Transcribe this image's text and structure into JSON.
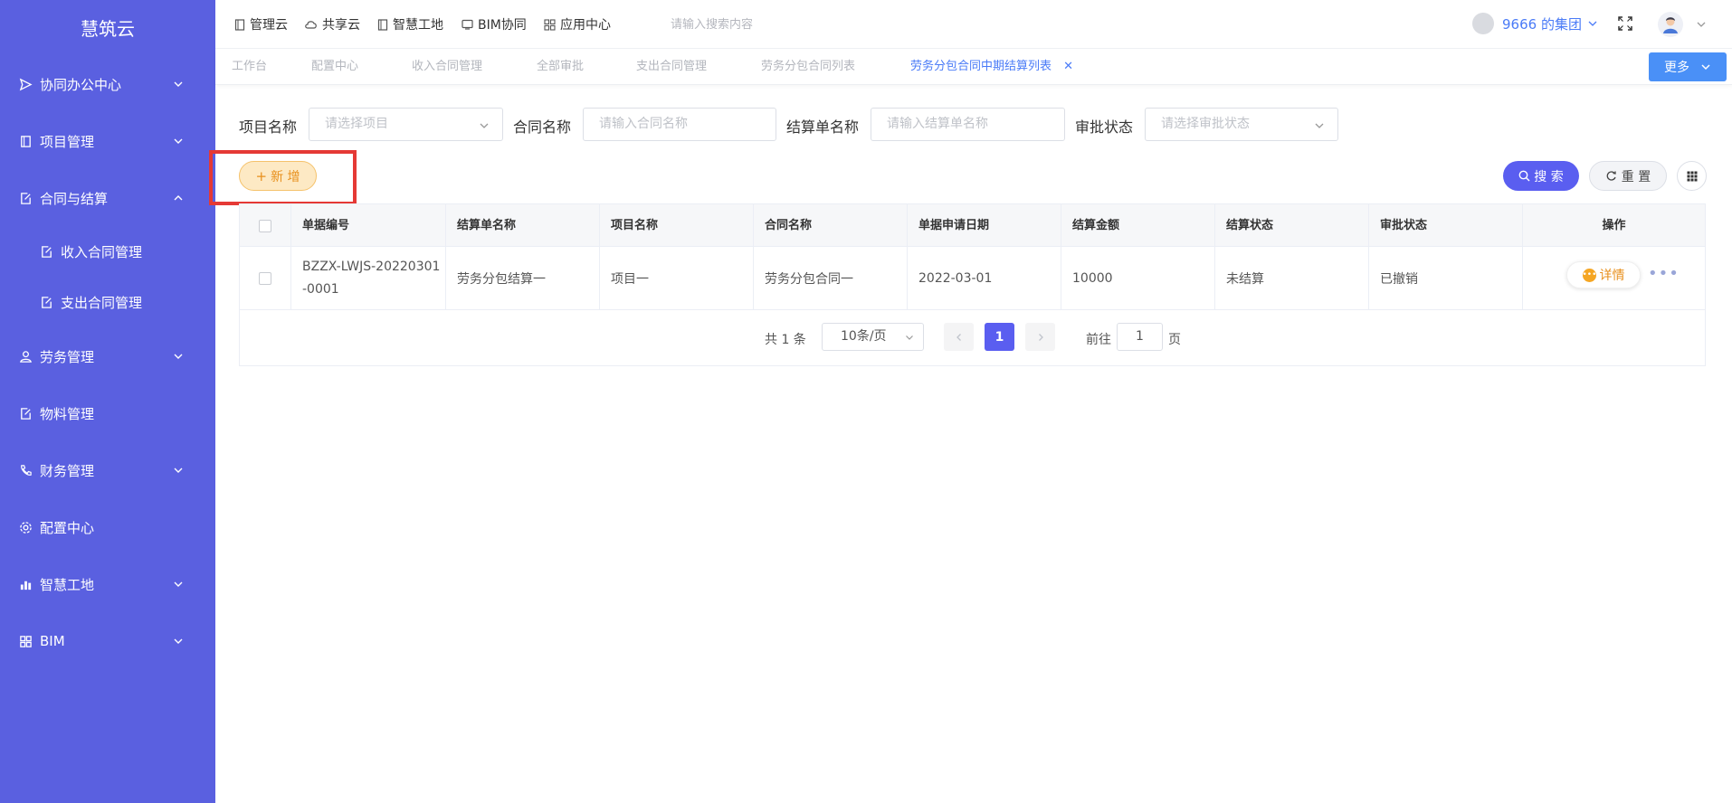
{
  "sidebar": {
    "logo": "慧筑云",
    "items": [
      {
        "label": "协同办公中心",
        "icon": "send-icon",
        "expanded": false
      },
      {
        "label": "项目管理",
        "icon": "book-icon",
        "expanded": false
      },
      {
        "label": "合同与结算",
        "icon": "edit-doc-icon",
        "expanded": true
      },
      {
        "label": "收入合同管理",
        "icon": "edit-doc-icon"
      },
      {
        "label": "支出合同管理",
        "icon": "edit-doc-icon"
      },
      {
        "label": "劳务管理",
        "icon": "worker-icon",
        "expanded": false
      },
      {
        "label": "物料管理",
        "icon": "edit-doc-icon"
      },
      {
        "label": "财务管理",
        "icon": "phone-icon",
        "expanded": false
      },
      {
        "label": "配置中心",
        "icon": "gear-icon"
      },
      {
        "label": "智慧工地",
        "icon": "bar-chart-icon",
        "expanded": false
      },
      {
        "label": "BIM",
        "icon": "grid-icon",
        "expanded": false
      }
    ]
  },
  "topbar": {
    "nav": [
      "管理云",
      "共享云",
      "智慧工地",
      "BIM协同",
      "应用中心"
    ],
    "search_placeholder": "请输入搜索内容",
    "org": "9666 的集团"
  },
  "tabs": [
    {
      "label": "工作台",
      "active": false
    },
    {
      "label": "配置中心",
      "active": false
    },
    {
      "label": "收入合同管理",
      "active": false
    },
    {
      "label": "全部审批",
      "active": false
    },
    {
      "label": "支出合同管理",
      "active": false
    },
    {
      "label": "劳务分包合同列表",
      "active": false
    },
    {
      "label": "劳务分包合同中期结算列表",
      "active": true
    }
  ],
  "more_label": "更多",
  "filters": {
    "project_label": "项目名称",
    "project_placeholder": "请选择项目",
    "contract_label": "合同名称",
    "contract_placeholder": "请输入合同名称",
    "settlement_label": "结算单名称",
    "settlement_placeholder": "请输入结算单名称",
    "approval_label": "审批状态",
    "approval_placeholder": "请选择审批状态"
  },
  "actions": {
    "add_label": "新 增",
    "search_label": "搜 索",
    "reset_label": "重 置"
  },
  "table": {
    "headers": [
      "单据编号",
      "结算单名称",
      "项目名称",
      "合同名称",
      "单据申请日期",
      "结算金额",
      "结算状态",
      "审批状态",
      "操作"
    ],
    "rows": [
      {
        "code_line1": "BZZX-LWJS-20220301",
        "code_line2": "-0001",
        "settlement": "劳务分包结算一",
        "project": "项目一",
        "contract": "劳务分包合同一",
        "date": "2022-03-01",
        "amount": "10000",
        "settle_status": "未结算",
        "approval_status": "已撤销",
        "detail_label": "详情"
      }
    ]
  },
  "pagination": {
    "total": "共 1 条",
    "page_size": "10条/页",
    "current_page": "1",
    "goto_label": "前往",
    "goto_value": "1",
    "page_suffix": "页"
  },
  "colors": {
    "sidebar": "#5a60e0",
    "primary": "#5a5ef0",
    "accent_orange": "#e8901d",
    "highlight": "#e53935"
  }
}
